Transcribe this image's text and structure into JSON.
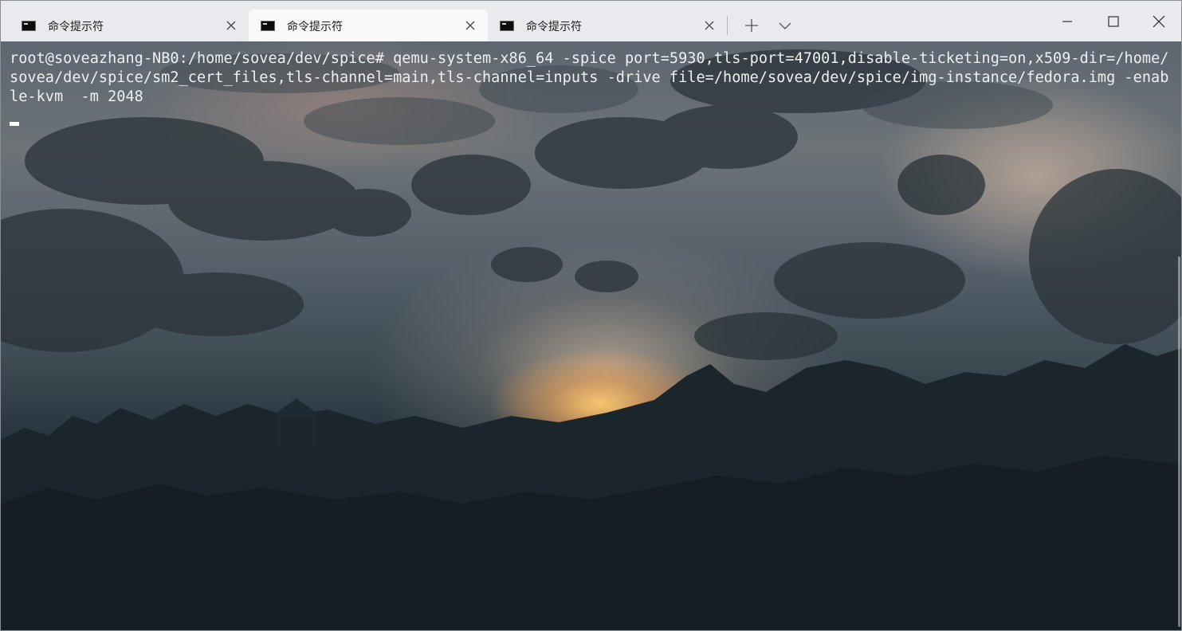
{
  "tabs": [
    {
      "title": "命令提示符",
      "active": false
    },
    {
      "title": "命令提示符",
      "active": true
    },
    {
      "title": "命令提示符",
      "active": false
    }
  ],
  "toolbar": {
    "new_tab_icon": "plus-icon",
    "dropdown_icon": "chevron-down-icon"
  },
  "window_controls": {
    "minimize_icon": "minimize-icon",
    "maximize_icon": "maximize-icon",
    "close_icon": "close-icon"
  },
  "terminal": {
    "prompt": "root@soveazhang-NB0:/home/sovea/dev/spice#",
    "command": "qemu-system-x86_64 -spice port=5930,tls-port=47001,disable-ticketing=on,x509-dir=/home/sovea/dev/spice/sm2_cert_files,tls-channel=main,tls-channel=inputs -drive file=/home/sovea/dev/spice/img-instance/fedora.img -enable-kvm  -m 2048"
  },
  "colors": {
    "tabbar_bg": "#e8eaed",
    "active_tab_bg": "#f9f9f9",
    "terminal_text": "#eef0f2"
  }
}
